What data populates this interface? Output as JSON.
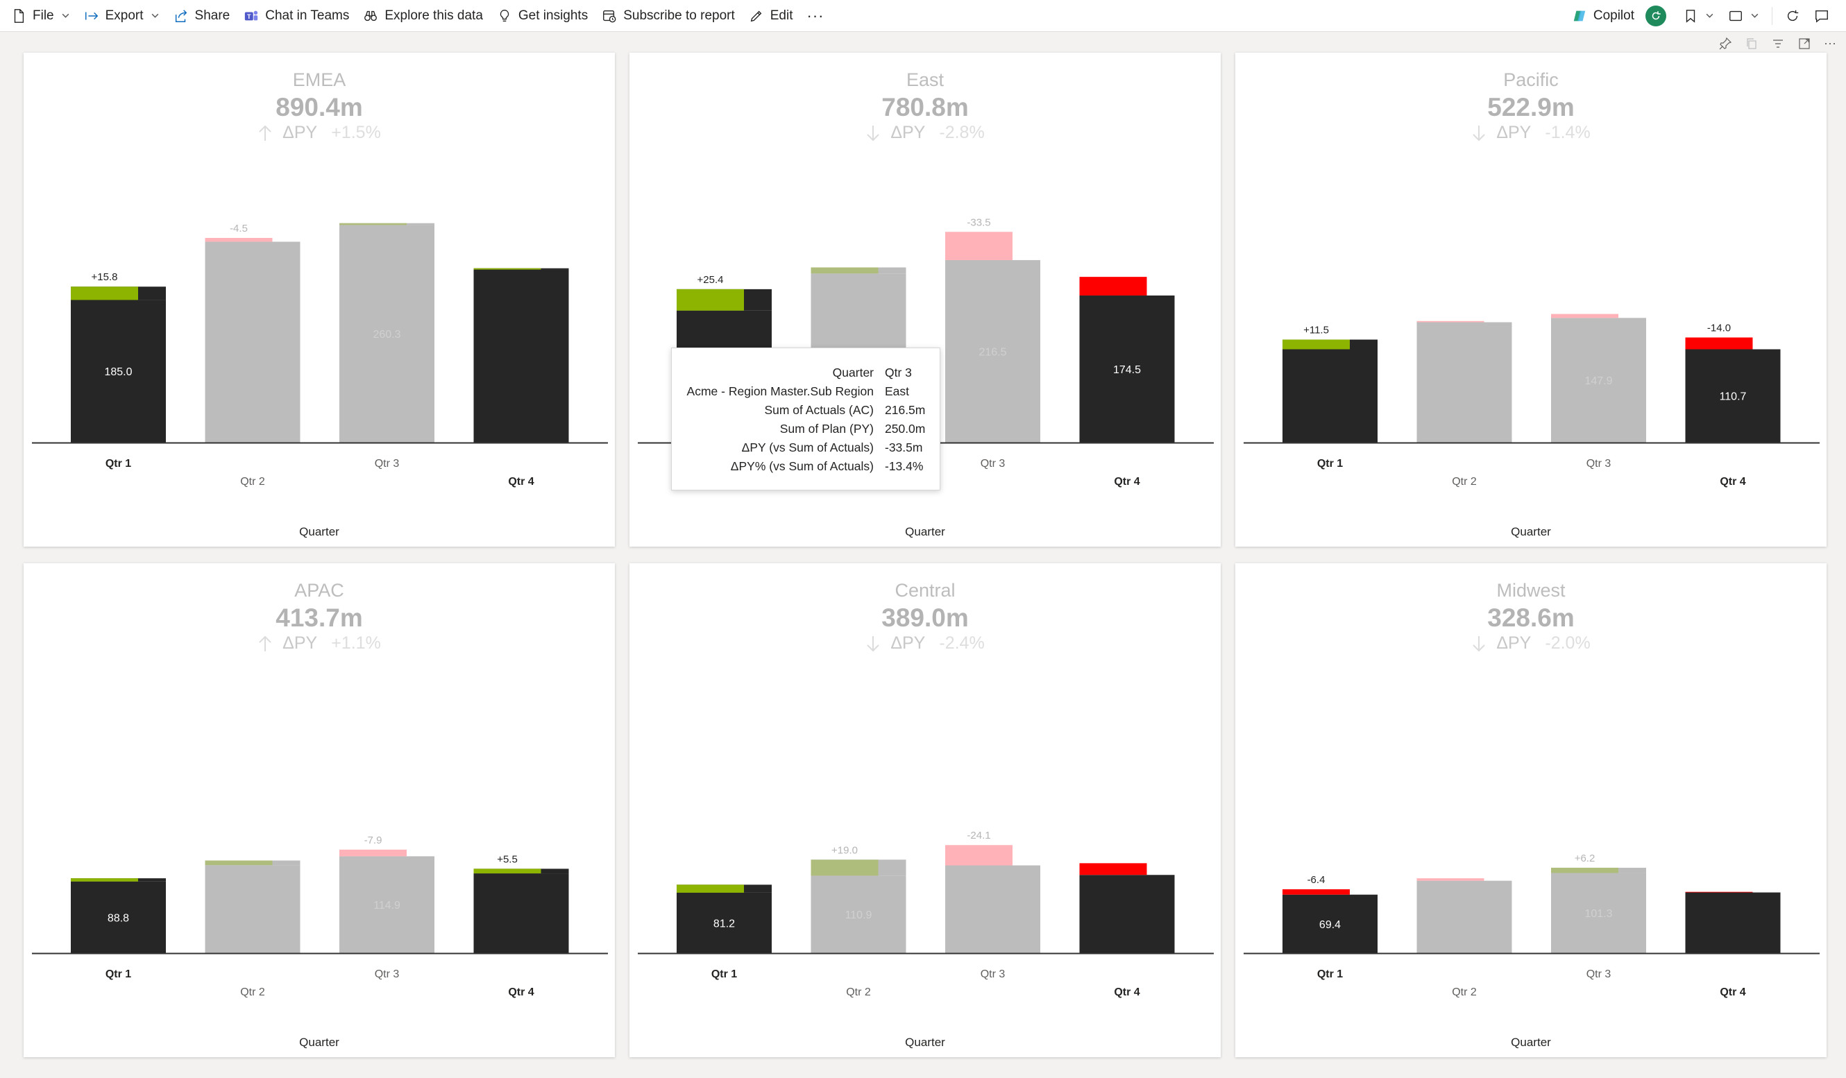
{
  "toolbar": {
    "file": "File",
    "export": "Export",
    "share": "Share",
    "chat_in_teams": "Chat in Teams",
    "explore": "Explore this data",
    "insights": "Get insights",
    "subscribe": "Subscribe to report",
    "edit": "Edit",
    "more": "···",
    "copilot": "Copilot"
  },
  "visual_header_more": "···",
  "colors": {
    "actual": "#262626",
    "plan_gray": "#bcbcbc",
    "positive": "#8cb400",
    "negative": "#ff0000",
    "positive_muted": "#aebd7c",
    "negative_muted": "#ffb3b8"
  },
  "axis_title": "Quarter",
  "delta_label": "ΔPY",
  "panels": [
    {
      "title": "EMEA",
      "total": "890.4m",
      "direction": "up",
      "delta_pct": "+1.5%",
      "chart_data": {
        "type": "bar",
        "categories": [
          "Qtr 1",
          "Qtr 2",
          "Qtr 3",
          "Qtr 4"
        ],
        "actual": [
          185.0,
          238.3,
          260.3,
          206.8
        ],
        "plan": [
          169.2,
          242.8,
          258.1,
          205.3
        ],
        "delta_labels": [
          "+15.8",
          "-4.5",
          "",
          ""
        ],
        "value_labels": [
          "185.0",
          "",
          "260.3",
          ""
        ],
        "highlighted": [
          true,
          false,
          false,
          true
        ],
        "ylim": [
          0,
          300
        ]
      }
    },
    {
      "title": "East",
      "total": "780.8m",
      "direction": "down",
      "delta_pct": "-2.8%",
      "chart_data": {
        "type": "bar",
        "categories": [
          "Qtr 1",
          "Qtr 2",
          "Qtr 3",
          "Qtr 4"
        ],
        "actual": [
          182.0,
          207.8,
          216.5,
          174.5
        ],
        "plan": [
          156.6,
          200.6,
          250.0,
          196.6
        ],
        "delta_labels": [
          "+25.4",
          "",
          "-33.5",
          ""
        ],
        "value_labels": [
          "",
          "",
          "216.5",
          "174.5"
        ],
        "highlighted": [
          true,
          false,
          false,
          true
        ],
        "ylim": [
          0,
          300
        ]
      }
    },
    {
      "title": "Pacific",
      "total": "522.9m",
      "direction": "down",
      "delta_pct": "-1.4%",
      "chart_data": {
        "type": "bar",
        "categories": [
          "Qtr 1",
          "Qtr 2",
          "Qtr 3",
          "Qtr 4"
        ],
        "actual": [
          122.2,
          142.8,
          147.9,
          110.7
        ],
        "plan": [
          110.7,
          144.2,
          152.6,
          124.7
        ],
        "delta_labels": [
          "+11.5",
          "",
          "",
          "-14.0"
        ],
        "value_labels": [
          "",
          "",
          "147.9",
          "110.7"
        ],
        "highlighted": [
          true,
          false,
          false,
          true
        ],
        "ylim": [
          0,
          300
        ]
      }
    },
    {
      "title": "APAC",
      "total": "413.7m",
      "direction": "up",
      "delta_pct": "+1.1%",
      "chart_data": {
        "type": "bar",
        "categories": [
          "Qtr 1",
          "Qtr 2",
          "Qtr 3",
          "Qtr 4"
        ],
        "actual": [
          88.8,
          109.9,
          114.9,
          100.1
        ],
        "plan": [
          85.0,
          104.4,
          122.8,
          94.6
        ],
        "delta_labels": [
          "",
          "",
          "-7.9",
          "+5.5"
        ],
        "value_labels": [
          "88.8",
          "",
          "114.9",
          ""
        ],
        "highlighted": [
          true,
          false,
          false,
          true
        ],
        "ylim": [
          0,
          300
        ]
      }
    },
    {
      "title": "Central",
      "total": "389.0m",
      "direction": "down",
      "delta_pct": "-2.4%",
      "chart_data": {
        "type": "bar",
        "categories": [
          "Qtr 1",
          "Qtr 2",
          "Qtr 3",
          "Qtr 4"
        ],
        "actual": [
          81.2,
          110.9,
          104.1,
          92.8
        ],
        "plan": [
          71.7,
          91.9,
          128.2,
          106.7
        ],
        "delta_labels": [
          "",
          "+19.0",
          "-24.1",
          ""
        ],
        "value_labels": [
          "81.2",
          "110.9",
          "",
          ""
        ],
        "highlighted": [
          true,
          false,
          false,
          true
        ],
        "ylim": [
          0,
          300
        ]
      }
    },
    {
      "title": "Midwest",
      "total": "328.6m",
      "direction": "down",
      "delta_pct": "-2.0%",
      "chart_data": {
        "type": "bar",
        "categories": [
          "Qtr 1",
          "Qtr 2",
          "Qtr 3",
          "Qtr 4"
        ],
        "actual": [
          69.4,
          85.9,
          101.3,
          72.0
        ],
        "plan": [
          75.8,
          88.8,
          95.1,
          72.7
        ],
        "delta_labels": [
          "-6.4",
          "",
          "+6.2",
          ""
        ],
        "value_labels": [
          "69.4",
          "",
          "101.3",
          ""
        ],
        "highlighted": [
          true,
          false,
          false,
          true
        ],
        "ylim": [
          0,
          300
        ]
      }
    }
  ],
  "tooltip": {
    "rows": [
      {
        "key": "Quarter",
        "value": "Qtr 3"
      },
      {
        "key": "Acme - Region Master.Sub Region",
        "value": "East"
      },
      {
        "key": "Sum of Actuals (AC)",
        "value": "216.5m"
      },
      {
        "key": "Sum of Plan (PY)",
        "value": "250.0m"
      },
      {
        "key": "ΔPY (vs Sum of Actuals)",
        "value": "-33.5m"
      },
      {
        "key": "ΔPY% (vs Sum of Actuals)",
        "value": "-13.4%"
      }
    ]
  }
}
